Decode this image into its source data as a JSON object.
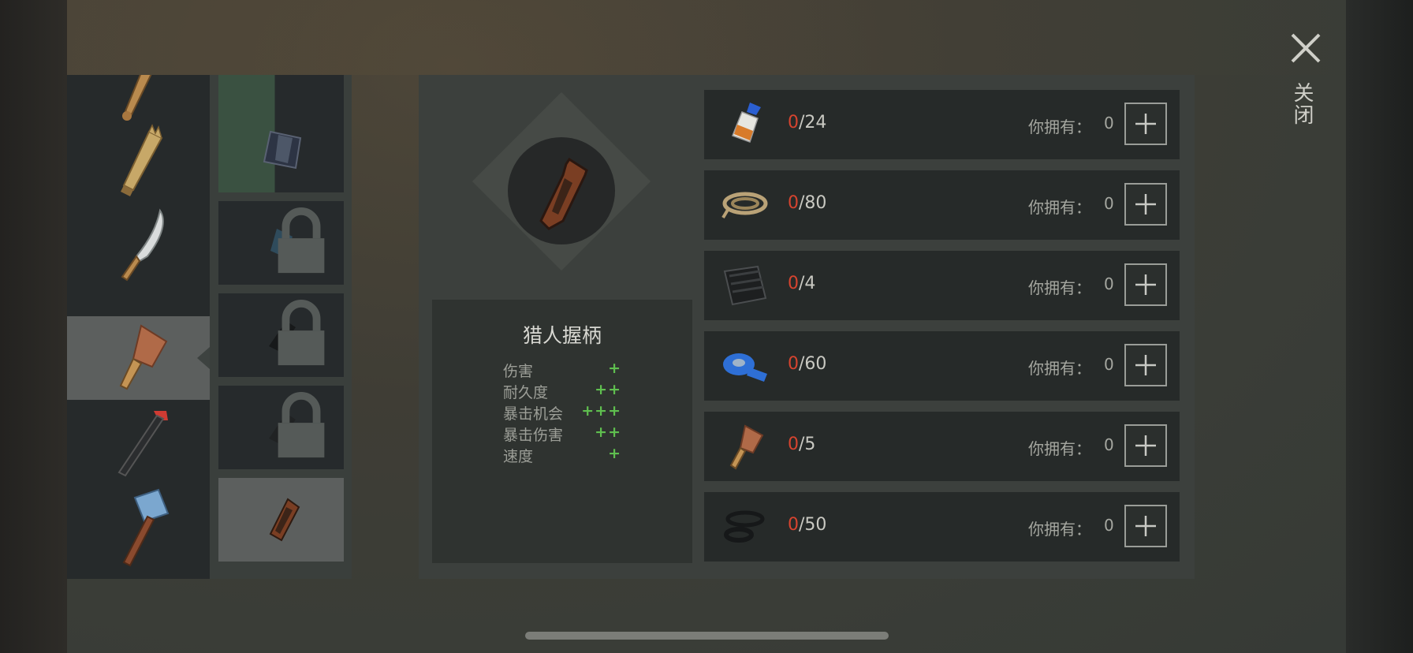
{
  "close": {
    "label": "关闭"
  },
  "weapons": [
    {
      "name": "baseball-bat"
    },
    {
      "name": "spiked-plank"
    },
    {
      "name": "machete"
    },
    {
      "name": "cleaver",
      "selected": true
    },
    {
      "name": "crowbar-pipe"
    },
    {
      "name": "sledgehammer"
    }
  ],
  "mods": [
    {
      "name": "partial-top-mod"
    },
    {
      "name": "cleaver-blade",
      "state": "unlocked"
    },
    {
      "name": "tape-wrap",
      "locked": true
    },
    {
      "name": "grip-black",
      "locked": true
    },
    {
      "name": "grip-black-2",
      "locked": true
    },
    {
      "name": "hunter-grip",
      "selected": true
    }
  ],
  "item": {
    "name": "猎人握柄",
    "stats": [
      {
        "label": "伤害",
        "value": "+"
      },
      {
        "label": "耐久度",
        "value": "++"
      },
      {
        "label": "暴击机会",
        "value": "+++"
      },
      {
        "label": "暴击伤害",
        "value": "++"
      },
      {
        "label": "速度",
        "value": "+"
      }
    ]
  },
  "materials": [
    {
      "icon": "glue-icon",
      "have": "0",
      "need": "/24",
      "own_label": "你拥有：",
      "own": "0"
    },
    {
      "icon": "rope-icon",
      "have": "0",
      "need": "/80",
      "own_label": "你拥有：",
      "own": "0"
    },
    {
      "icon": "rubber-sheet-icon",
      "have": "0",
      "need": "/4",
      "own_label": "你拥有：",
      "own": "0"
    },
    {
      "icon": "duct-tape-icon",
      "have": "0",
      "need": "/60",
      "own_label": "你拥有：",
      "own": "0"
    },
    {
      "icon": "cleaver-icon",
      "have": "0",
      "need": "/5",
      "own_label": "你拥有：",
      "own": "0"
    },
    {
      "icon": "rubber-rings-icon",
      "have": "0",
      "need": "/50",
      "own_label": "你拥有：",
      "own": "0"
    }
  ],
  "colors": {
    "have_red": "#d6442f",
    "stat_green": "#5fbf4f"
  }
}
